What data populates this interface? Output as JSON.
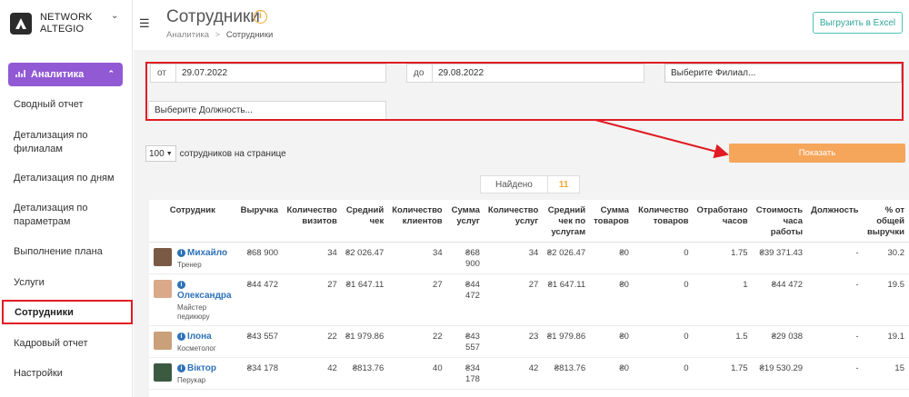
{
  "brand": {
    "line1": "NETWORK",
    "line2": "ALTEGIO"
  },
  "sidebar": {
    "section": "Аналитика",
    "items": [
      {
        "label": "Сводный отчет"
      },
      {
        "label": "Детализация по филиалам"
      },
      {
        "label": "Детализация по дням"
      },
      {
        "label": "Детализация по параметрам"
      },
      {
        "label": "Выполнение плана"
      },
      {
        "label": "Услуги"
      },
      {
        "label": "Сотрудники"
      },
      {
        "label": "Кадровый отчет"
      },
      {
        "label": "Настройки"
      }
    ]
  },
  "header": {
    "title": "Сотрудники",
    "breadcrumb_parent": "Аналитика",
    "breadcrumb_sep": ">",
    "breadcrumb_current": "Сотрудники",
    "export_label": "Выгрузить в Excel"
  },
  "filters": {
    "from_prefix": "от",
    "from_value": "29.07.2022",
    "to_prefix": "до",
    "to_value": "29.08.2022",
    "branch_placeholder": "Выберите Филиал...",
    "position_placeholder": "Выберите Должность..."
  },
  "perpage": {
    "value": "100",
    "label": "сотрудников на странице"
  },
  "show_button": "Показать",
  "found": {
    "label": "Найдено",
    "count": "11"
  },
  "table": {
    "headers": [
      "Сотрудник",
      "Выручка",
      "Количество визитов",
      "Средний чек",
      "Количество клиентов",
      "Сумма услуг",
      "Количество услуг",
      "Средний чек по услугам",
      "Сумма товаров",
      "Количество товаров",
      "Отработано часов",
      "Стоимость часа работы",
      "Должность",
      "% от общей выручки"
    ],
    "rows": [
      {
        "name": "Михайло",
        "role": "Тренер",
        "cells": [
          "₴68 900",
          "34",
          "₴2 026.47",
          "34",
          "₴68 900",
          "34",
          "₴2 026.47",
          "₴0",
          "0",
          "1.75",
          "₴39 371.43",
          "-",
          "30.2"
        ]
      },
      {
        "name": "Олександра",
        "role": "Майстер педикюру",
        "cells": [
          "₴44 472",
          "27",
          "₴1 647.11",
          "27",
          "₴44 472",
          "27",
          "₴1 647.11",
          "₴0",
          "0",
          "1",
          "₴44 472",
          "-",
          "19.5"
        ]
      },
      {
        "name": "Ілона",
        "role": "Косметолог",
        "cells": [
          "₴43 557",
          "22",
          "₴1 979.86",
          "22",
          "₴43 557",
          "23",
          "₴1 979.86",
          "₴0",
          "0",
          "1.5",
          "₴29 038",
          "-",
          "19.1"
        ]
      },
      {
        "name": "Віктор",
        "role": "Перукар",
        "cells": [
          "₴34 178",
          "42",
          "₴813.76",
          "40",
          "₴34 178",
          "42",
          "₴813.76",
          "₴0",
          "0",
          "1.75",
          "₴19 530.29",
          "-",
          "15"
        ]
      }
    ]
  },
  "colors": {
    "accent": "#9159d4",
    "highlight": "#e01b24",
    "show_button": "#f5a65b",
    "link": "#2e72b8"
  }
}
